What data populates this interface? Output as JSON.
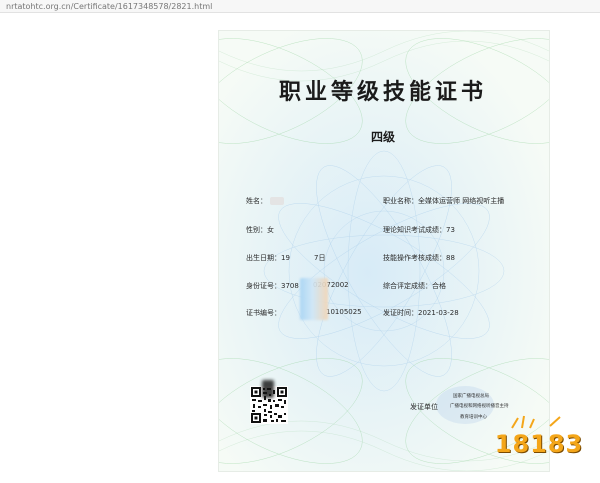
{
  "browser": {
    "url": "nrtatohtc.org.cn/Certificate/1617348578/2821.html"
  },
  "certificate": {
    "title": "职业等级技能证书",
    "level": "四级",
    "left_fields": [
      {
        "label": "姓名：",
        "value": ""
      },
      {
        "label": "性别：",
        "value": "女"
      },
      {
        "label": "出生日期：",
        "value": "19",
        "value_tail": "7日"
      },
      {
        "label": "身份证号：",
        "value": "3708",
        "value_tail": "02072002"
      },
      {
        "label": "证书编号：",
        "value": "",
        "value_tail": "10105025"
      }
    ],
    "right_fields": [
      {
        "label": "职业名称：",
        "value": "全媒体运营师 网络视听主播"
      },
      {
        "label": "理论知识考试成绩：",
        "value": "73"
      },
      {
        "label": "技能操作考核成绩：",
        "value": "88"
      },
      {
        "label": "综合评定成绩：",
        "value": "合格"
      },
      {
        "label": "发证时间：",
        "value": "2021-03-28"
      }
    ],
    "issuer_label": "发证单位",
    "issuer_orgs": [
      "国家广播电视总局",
      "广播电视和网络视听播音主持",
      "教育培训中心"
    ]
  },
  "watermark": {
    "text": "18183"
  },
  "colors": {
    "background": "#f6fbf6",
    "guilloche_green": "#8fcf96",
    "guilloche_blue": "#a9cdea",
    "logo_orange": "#f4a61a",
    "redaction_blue": "#a7d4f3",
    "redaction_peach": "#f3d4b2"
  }
}
